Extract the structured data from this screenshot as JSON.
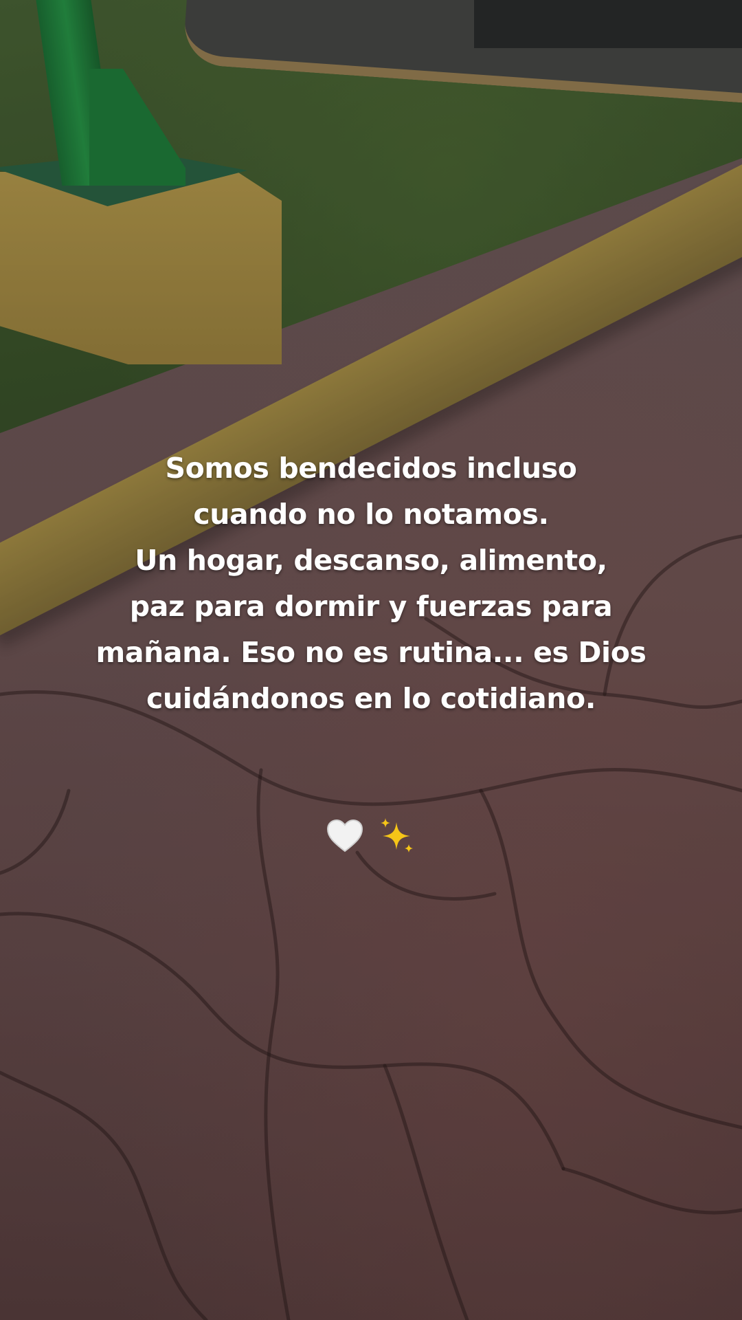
{
  "caption": {
    "lines": [
      "Somos bendecidos incluso",
      "cuando no lo notamos.",
      "Un hogar, descanso, alimento,",
      "paz para dormir y fuerzas para",
      "mañana. Eso no es rutina... es Dios",
      "cuidándonos en lo cotidiano."
    ]
  },
  "emojis": {
    "items": [
      "white-heart-icon",
      "sparkles-icon"
    ],
    "heart_color": "#f2f2f2",
    "sparkle_color": "#f5c518"
  },
  "colors": {
    "text": "#ffffff",
    "grass": "#3f5a2e",
    "curb": "#b49a4c",
    "pole": "#22873f",
    "pavement": "#7a5d5c"
  }
}
